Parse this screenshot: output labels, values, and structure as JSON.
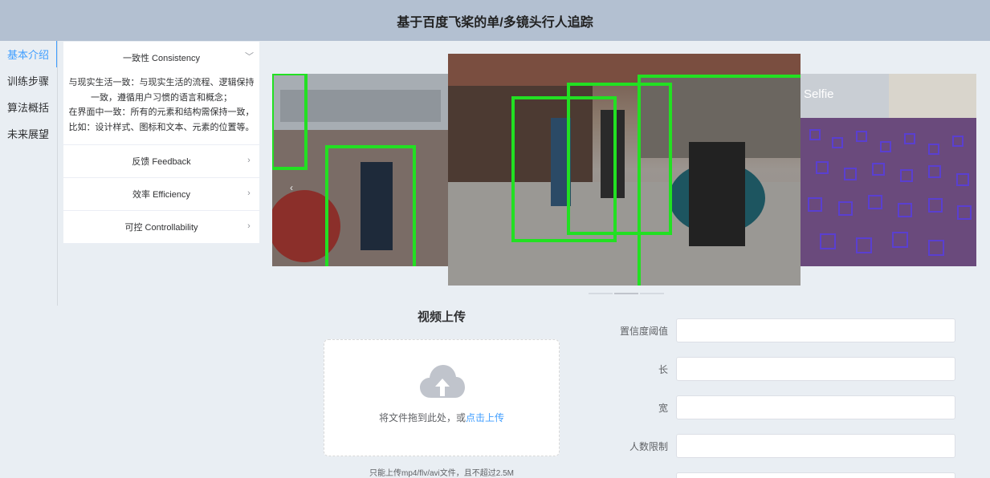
{
  "header": {
    "title": "基于百度飞桨的单/多镜头行人追踪"
  },
  "sidebar": {
    "items": [
      {
        "label": "基本介绍",
        "active": true
      },
      {
        "label": "训练步骤",
        "active": false
      },
      {
        "label": "算法概括",
        "active": false
      },
      {
        "label": "未来展望",
        "active": false
      }
    ]
  },
  "collapse": {
    "items": [
      {
        "title": "一致性 Consistency",
        "expanded": true,
        "body_lines": [
          "与现实生活一致：与现实生活的流程、逻辑保持一致，遵循用户习惯的语言和概念；",
          "在界面中一致：所有的元素和结构需保持一致，比如：设计样式、图标和文本、元素的位置等。"
        ]
      },
      {
        "title": "反馈 Feedback",
        "expanded": false
      },
      {
        "title": "效率 Efficiency",
        "expanded": false
      },
      {
        "title": "可控 Controllability",
        "expanded": false
      }
    ]
  },
  "carousel": {
    "slides": [
      {
        "label": "Selfie"
      }
    ],
    "indicator_count": 3,
    "active_indicator": 1
  },
  "upload": {
    "title": "视频上传",
    "drop_text": "将文件拖到此处，或",
    "click_text": "点击上传",
    "tip": "只能上传mp4/flv/avi文件，且不超过2.5M"
  },
  "form": {
    "fields": [
      {
        "label": "置信度阈值",
        "value": ""
      },
      {
        "label": "长",
        "value": ""
      },
      {
        "label": "宽",
        "value": ""
      },
      {
        "label": "人数限制",
        "value": ""
      }
    ]
  },
  "colors": {
    "accent": "#409eff",
    "header_bg": "#b3c0d1",
    "page_bg": "#e9eef3",
    "detection_box": "#22e022",
    "face_box": "#5a3fd0"
  }
}
